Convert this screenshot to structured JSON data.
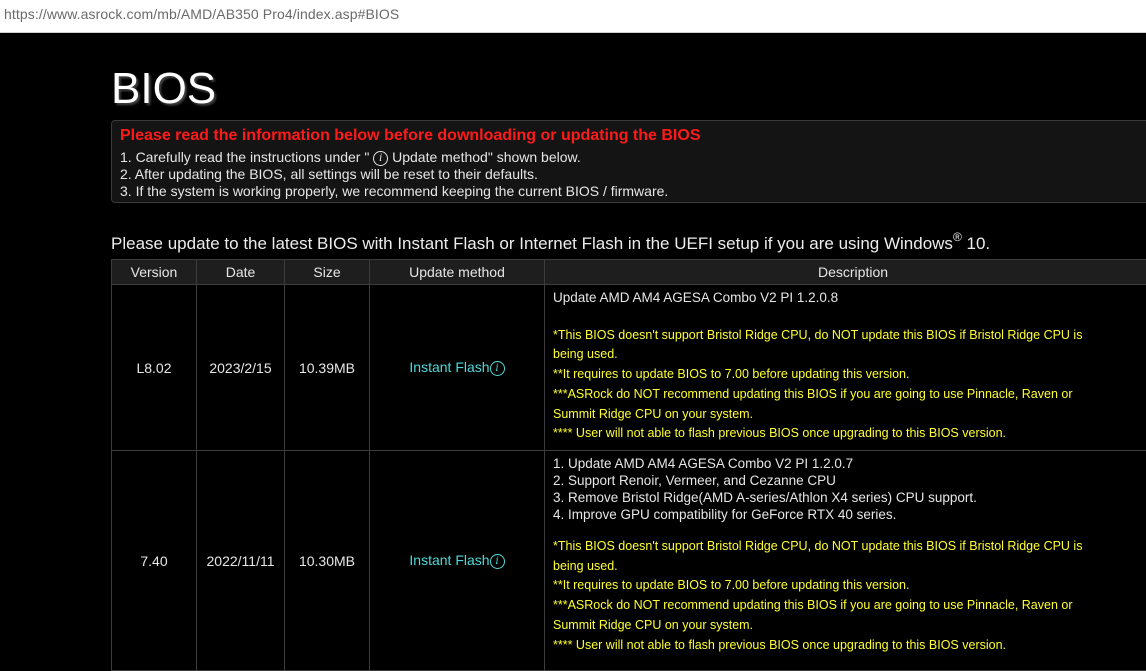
{
  "browser": {
    "url": "https://www.asrock.com/mb/AMD/AB350 Pro4/index.asp#BIOS"
  },
  "page": {
    "title": "BIOS",
    "notice": {
      "heading": "Please read the information below before downloading or updating the BIOS",
      "line1_before": "1. Carefully read the instructions under \" ",
      "line1_icon": "i",
      "line1_after": " Update method\" shown below.",
      "line2": "2. After updating the BIOS, all settings will be reset to their defaults.",
      "line3": "3. If the system is working properly, we recommend keeping the current BIOS / firmware."
    },
    "intro": {
      "text": "Please update to the latest BIOS with Instant Flash or Internet Flash in the UEFI setup if you are using Windows",
      "sup": "®",
      "suffix": " 10."
    }
  },
  "table": {
    "headers": {
      "version": "Version",
      "date": "Date",
      "size": "Size",
      "method": "Update method",
      "description": "Description"
    },
    "rows": [
      {
        "version": "L8.02",
        "date": "2023/2/15",
        "size": "10.39MB",
        "method": "Instant Flash",
        "desc_white": [
          "Update AMD AM4 AGESA Combo V2 PI 1.2.0.8"
        ],
        "desc_yellow": [
          "*This BIOS doesn't support Bristol Ridge CPU, do NOT update this BIOS if Bristol Ridge CPU is",
          "being used.",
          "**It requires to update BIOS to 7.00 before updating this version.",
          "***ASRock do NOT recommend updating this BIOS if you are going to use Pinnacle, Raven or",
          "Summit Ridge CPU on your system.",
          "**** User will not able to flash previous BIOS once upgrading to this BIOS version."
        ]
      },
      {
        "version": "7.40",
        "date": "2022/11/11",
        "size": "10.30MB",
        "method": "Instant Flash",
        "desc_white": [
          "1. Update AMD AM4 AGESA Combo V2 PI 1.2.0.7",
          "2. Support Renoir, Vermeer, and Cezanne CPU",
          "3. Remove Bristol Ridge(AMD A-series/Athlon X4 series) CPU support.",
          "4. Improve GPU compatibility for GeForce RTX 40 series."
        ],
        "desc_yellow": [
          "*This BIOS doesn't support Bristol Ridge CPU, do NOT update this BIOS if Bristol Ridge CPU is",
          "being used.",
          "**It requires to update BIOS to 7.00 before updating this version.",
          "***ASRock do NOT recommend updating this BIOS if you are going to use Pinnacle, Raven or",
          "Summit Ridge CPU on your system.",
          "**** User will not able to flash previous BIOS once upgrading to this BIOS version."
        ]
      }
    ]
  },
  "colors": {
    "background": "#000000",
    "heading_red": "#ff1a1a",
    "note_yellow": "#ffff33",
    "link_cyan": "#4fd9d9"
  },
  "icons": {
    "info": "info-circle-icon"
  }
}
